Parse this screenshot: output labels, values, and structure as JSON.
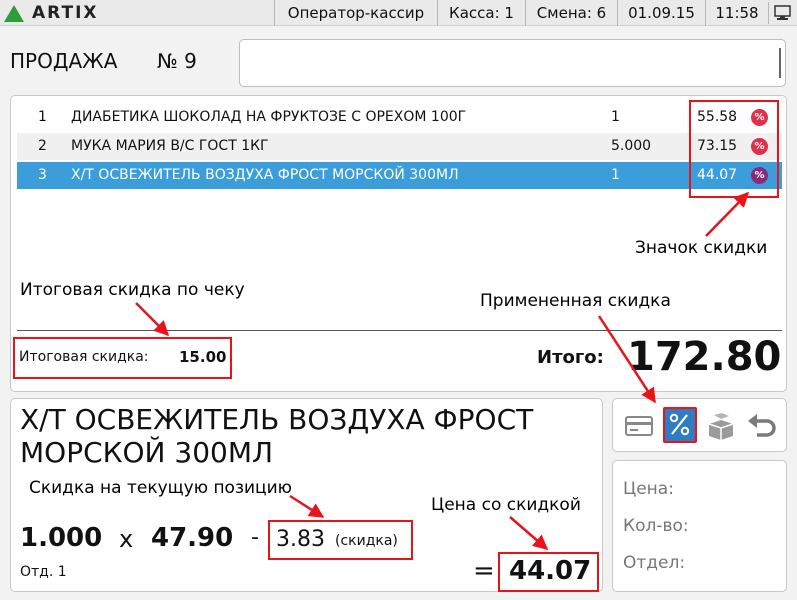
{
  "topbar": {
    "brand": "ARTIX",
    "operator": "Оператор-кассир",
    "register": "Касса: 1",
    "shift": "Смена: 6",
    "date": "01.09.15",
    "time": "11:58"
  },
  "sale": {
    "title": "ПРОДАЖА",
    "number": "№ 9",
    "input_value": ""
  },
  "receipt": {
    "items": [
      {
        "index": "1",
        "name": "ДИАБЕТИКА ШОКОЛАД НА ФРУКТОЗЕ С ОРЕХОМ 100Г",
        "qty": "1",
        "price": "55.58",
        "badge": "%"
      },
      {
        "index": "2",
        "name": "МУКА МАРИЯ В/С ГОСТ 1КГ",
        "qty": "5.000",
        "price": "73.15",
        "badge": "%"
      },
      {
        "index": "3",
        "name": "Х/Т ОСВЕЖИТЕЛЬ ВОЗДУХА ФРОСТ МОРСКОЙ 300МЛ",
        "qty": "1",
        "price": "44.07",
        "badge": "%"
      }
    ],
    "selected_index": 2,
    "total_discount_label": "Итоговая скидка:",
    "total_discount_value": "15.00",
    "total_label": "Итого:",
    "total_value": "172.80"
  },
  "current_item": {
    "name": "Х/Т ОСВЕЖИТЕЛЬ ВОЗДУХА ФРОСТ МОРСКОЙ 300МЛ",
    "qty": "1.000",
    "times": "x",
    "price": "47.90",
    "minus": "-",
    "discount": "3.83",
    "discount_note": "(скидка)",
    "dept": "Отд. 1",
    "equals": "=",
    "final_price": "44.07"
  },
  "info": {
    "price_label": "Цена:",
    "qty_label": "Кол-во:",
    "dept_label": "Отдел:"
  },
  "annotations": {
    "discount_icon": "Значок скидки",
    "receipt_discount": "Итоговая скидка по чеку",
    "applied_discount": "Примененная скидка",
    "position_discount": "Скидка на текущую позицию",
    "discounted_price": "Цена со скидкой"
  },
  "colors": {
    "selection": "#3b9edb",
    "badge": "#e03048",
    "annotation": "#e8141c",
    "discount_button": "#2f7cc0"
  }
}
